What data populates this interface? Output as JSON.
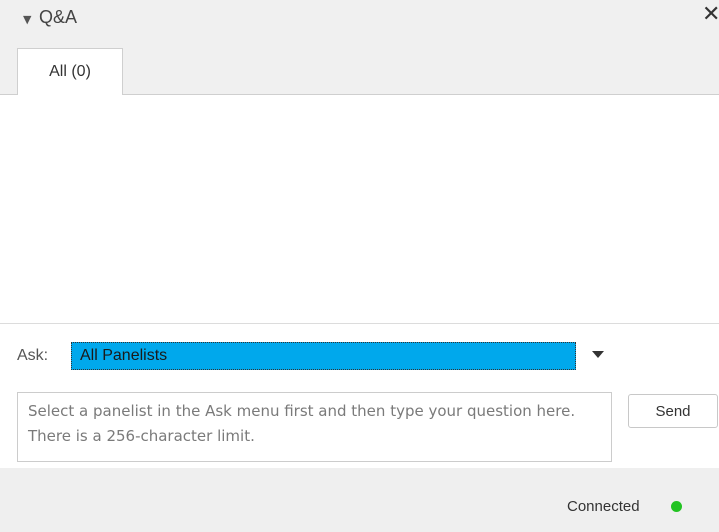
{
  "panel": {
    "title": "Q&A",
    "collapse_icon": "triangle-down-icon",
    "close_icon": "close-icon",
    "close_glyph": "✕"
  },
  "tabs": [
    {
      "label": "All (0)",
      "selected": true
    }
  ],
  "ask": {
    "label": "Ask:",
    "selected_option": "All Panelists",
    "dropdown_icon": "triangle-down-icon",
    "highlight_color": "#00a8ec"
  },
  "question": {
    "value": "",
    "placeholder": "Select a panelist in the Ask menu first and then type your question here. There is a 256-character limit."
  },
  "send_label": "Send",
  "status": {
    "text": "Connected",
    "indicator_color": "#22c322"
  }
}
